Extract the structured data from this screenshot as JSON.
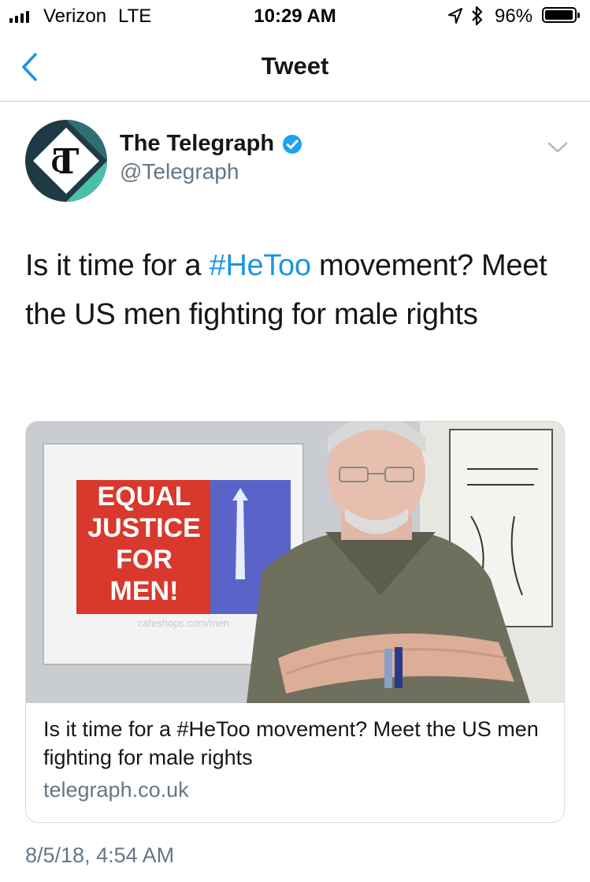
{
  "status_bar": {
    "carrier": "Verizon",
    "network": "LTE",
    "time": "10:29 AM",
    "battery_percent": "96%",
    "battery_level": 0.96
  },
  "nav": {
    "title": "Tweet"
  },
  "tweet": {
    "author_name": "The Telegraph",
    "author_handle": "@Telegraph",
    "text_before": "Is it time for a ",
    "hashtag": "#HeToo",
    "text_after": " movement? Meet the US men fighting for male rights",
    "timestamp": "8/5/18, 4:54 AM"
  },
  "card": {
    "sign_lines": [
      "EQUAL",
      "JUSTICE",
      "FOR",
      "MEN!"
    ],
    "sign_footer": "cafeshops.com/men",
    "title": "Is it time for a #HeToo movement? Meet the US men fighting for male rights",
    "domain": "telegraph.co.uk"
  },
  "colors": {
    "link": "#1b95e0",
    "verified": "#1da1f2",
    "secondary_text": "#657786",
    "sign_red": "#d9382c",
    "sign_blue": "#5a64c8",
    "logo_dark": "#1f3a44",
    "logo_teal": "#4cbfa8"
  },
  "icons": {
    "back": "chevron-left-icon",
    "verified": "verified-badge-icon",
    "more": "chevron-down-icon",
    "location": "location-arrow-icon",
    "bluetooth": "bluetooth-icon"
  }
}
